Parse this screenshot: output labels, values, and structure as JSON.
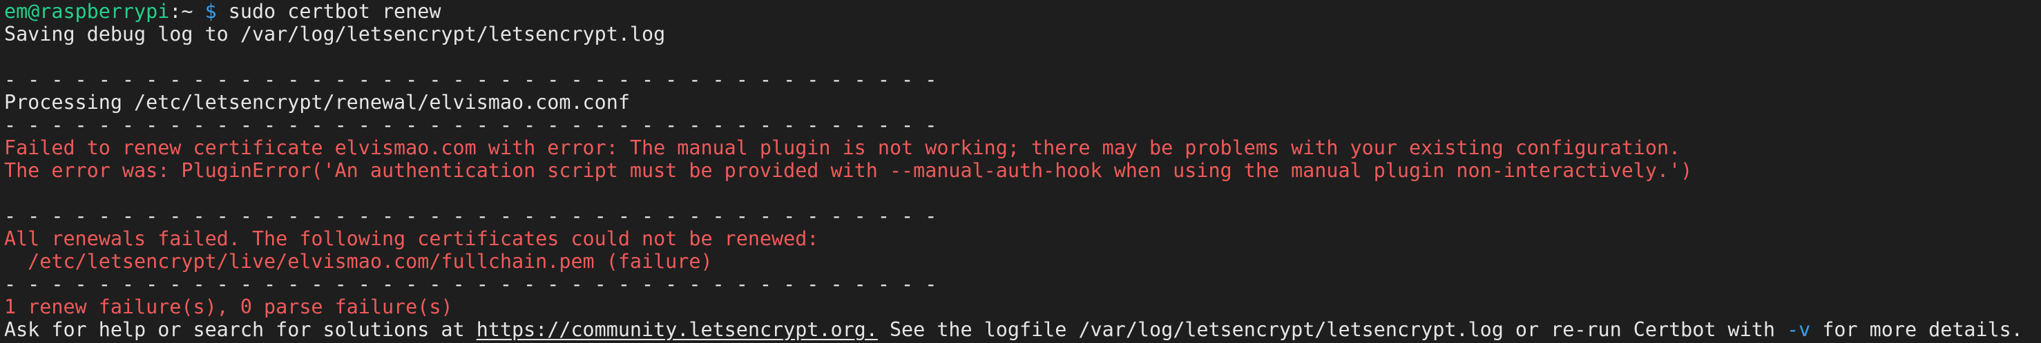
{
  "colors": {
    "background": "#1e1e1e",
    "text": "#e6e6e6",
    "prompt_user": "#23d18b",
    "prompt_symbol": "#3b9ee8",
    "error": "#f05a5a"
  },
  "prompt": {
    "user_host": "em@raspberrypi",
    "path": ":~",
    "symbol": " $ ",
    "command": "sudo certbot renew"
  },
  "lines": {
    "saving": "Saving debug log to /var/log/letsencrypt/letsencrypt.log",
    "separator": "- - - - - - - - - - - - - - - - - - - - - - - - - - - - - - - - - - - - - - - -",
    "processing": "Processing /etc/letsencrypt/renewal/elvismao.com.conf",
    "failed_renew": "Failed to renew certificate elvismao.com with error: The manual plugin is not working; there may be problems with your existing configuration.",
    "error_was": "The error was: PluginError('An authentication script must be provided with --manual-auth-hook when using the manual plugin non-interactively.')",
    "all_failed": "All renewals failed. The following certificates could not be renewed:",
    "failed_cert": "  /etc/letsencrypt/live/elvismao.com/fullchain.pem (failure)",
    "summary": "1 renew failure(s), 0 parse failure(s)",
    "help_prefix": "Ask for help or search for solutions at ",
    "help_link": "https://community.letsencrypt.org.",
    "help_middle": " See the logfile /var/log/letsencrypt/letsencrypt.log or re-run Certbot with ",
    "help_flag": "-v",
    "help_suffix": " for more details."
  }
}
